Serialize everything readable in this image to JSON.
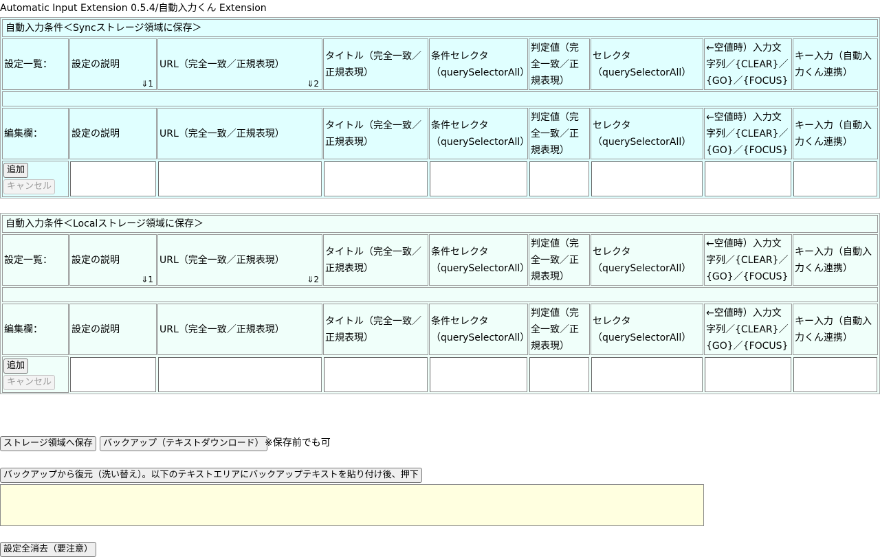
{
  "app_title": "Automatic Input Extension 0.5.4/自動入力くん Extension",
  "sync": {
    "heading": "自動入力条件＜Syncストレージ領域に保存＞",
    "list_label": "設定一覧：",
    "edit_label": "編集欄：",
    "sort_desc": "⇓1",
    "sort_url": "⇓2",
    "add_button": "追加",
    "cancel_button": "キャンセル"
  },
  "local": {
    "heading": "自動入力条件＜Localストレージ領域に保存＞",
    "list_label": "設定一覧：",
    "edit_label": "編集欄：",
    "sort_desc": "⇓1",
    "sort_url": "⇓2",
    "add_button": "追加",
    "cancel_button": "キャンセル"
  },
  "columns": {
    "description": "設定の説明",
    "url": "URL（完全一致／正規表現）",
    "title": "タイトル（完全一致／正規表現）",
    "condition_selector": "条件セレクタ（querySelectorAll）",
    "judge_value": "判定値（完全一致／正規表現）",
    "selector": "セレクタ（querySelectorAll）",
    "input_text": "←空値時）入力文字列／{CLEAR}／{GO}／{FOCUS}",
    "key_input": "キー入力（自動入力くん連携）"
  },
  "footer": {
    "save_button": "ストレージ領域へ保存",
    "backup_button": "バックアップ（テキストダウンロード）",
    "backup_note": "※保存前でも可",
    "restore_button": "バックアップから復元（洗い替え）。以下のテキストエリアにバックアップテキストを貼り付け後、押下",
    "restore_textarea_value": "",
    "clear_all_button": "設定全消去（要注意）"
  }
}
